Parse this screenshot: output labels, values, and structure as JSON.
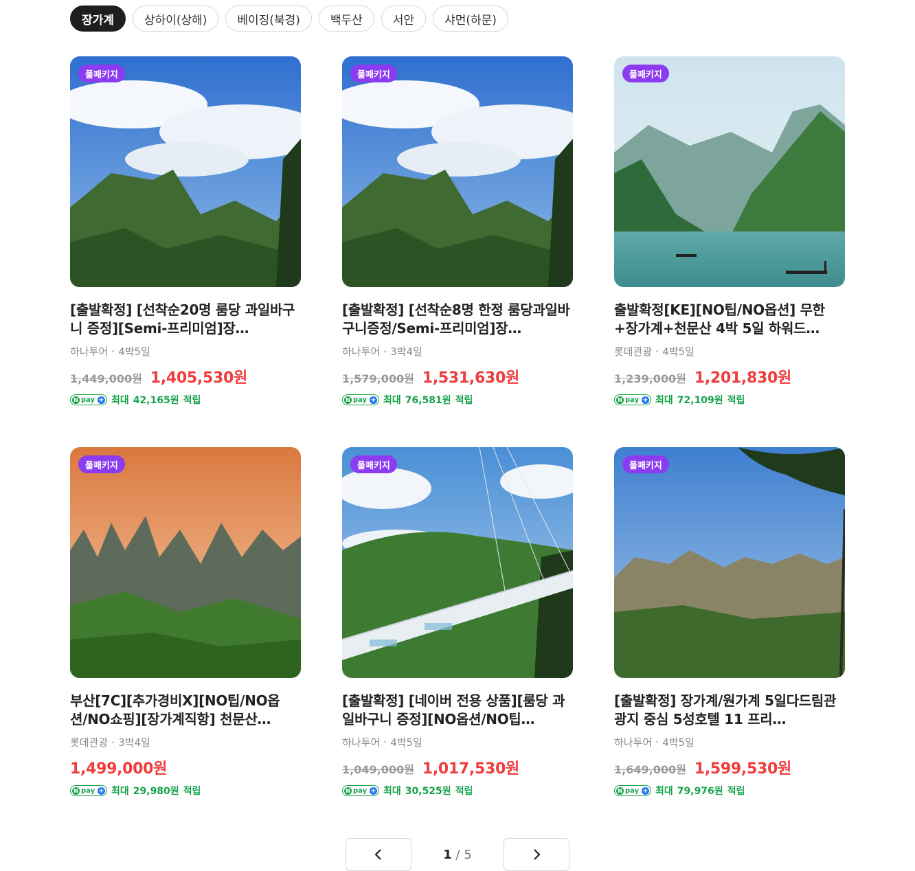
{
  "tabs": [
    {
      "label": "장가계",
      "active": true
    },
    {
      "label": "상하이(상해)",
      "active": false
    },
    {
      "label": "베이징(북경)",
      "active": false
    },
    {
      "label": "백두산",
      "active": false
    },
    {
      "label": "서안",
      "active": false
    },
    {
      "label": "샤먼(하문)",
      "active": false
    }
  ],
  "badge_label": "풀패키지",
  "point_prefix": "최대",
  "point_suffix": "적립",
  "npay_label": "pay",
  "products": [
    {
      "title": "[출발확정] [선착순20명 룸당 과일바구니 증정][Semi-프리미엄]장…",
      "agency": "하나투어",
      "duration": "4박5일",
      "original_price": "1,449,000원",
      "sale_price": "1,405,530원",
      "points": "42,165원",
      "image": "mountain-clouds"
    },
    {
      "title": "[출발확정] [선착순8명 한정 룸당과일바구니증정/Semi-프리미엄]장…",
      "agency": "하나투어",
      "duration": "3박4일",
      "original_price": "1,579,000원",
      "sale_price": "1,531,630원",
      "points": "76,581원",
      "image": "mountain-clouds"
    },
    {
      "title": "출발확정[KE][NO팁/NO옵션] 무한+장가계+천문산 4박 5일 하워드…",
      "agency": "롯데관광",
      "duration": "4박5일",
      "original_price": "1,239,000원",
      "sale_price": "1,201,830원",
      "points": "72,109원",
      "image": "river-boats"
    },
    {
      "title": "부산[7C][추가경비X][NO팁/NO옵션/NO쇼핑][장가계직항] 천문산…",
      "agency": "롯데관광",
      "duration": "3박4일",
      "original_price": "",
      "sale_price": "1,499,000원",
      "points": "29,980원",
      "image": "sunset-peaks"
    },
    {
      "title": "[출발확정] [네이버 전용 상품][룸당 과일바구니 증정][NO옵션/NO팁…",
      "agency": "하나투어",
      "duration": "4박5일",
      "original_price": "1,049,000원",
      "sale_price": "1,017,530원",
      "points": "30,525원",
      "image": "glass-bridge"
    },
    {
      "title": "[출발확정] 장가계/원가계 5일다드림관광지 중심 5성호텔 11 프리…",
      "agency": "하나투어",
      "duration": "4박5일",
      "original_price": "1,649,000원",
      "sale_price": "1,599,530원",
      "points": "79,976원",
      "image": "cliffs-pine"
    }
  ],
  "pagination": {
    "current": "1",
    "separator": "/",
    "total": "5"
  },
  "colors": {
    "badge": "#8c3cf0",
    "sale": "#f03c3c",
    "points": "#16a34a",
    "active_tab": "#1e1e1e"
  }
}
